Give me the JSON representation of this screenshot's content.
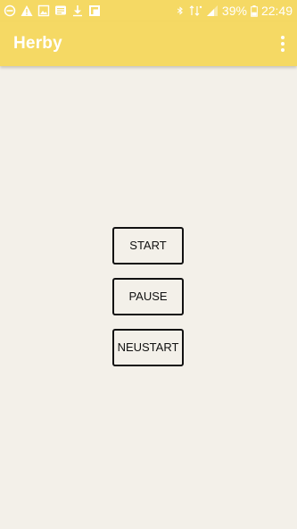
{
  "status_bar": {
    "left_icons": [
      "do-not-disturb-icon",
      "warning-icon",
      "image-icon",
      "message-icon",
      "download-icon",
      "flipboard-icon"
    ],
    "right_icons": [
      "bluetooth-icon",
      "volte-signal-icon",
      "cell-signal-icon"
    ],
    "battery_percent": "39%",
    "time": "22:49",
    "text_color": "#ffffff"
  },
  "app_bar": {
    "title": "Herby",
    "background_color": "#f5d964",
    "menu_icon": "more-vert-icon"
  },
  "controls": {
    "start_label": "START",
    "pause_label": "PAUSE",
    "restart_label": "NEUSTART"
  },
  "colors": {
    "background": "#f3f0e9",
    "button_border": "#111111"
  }
}
